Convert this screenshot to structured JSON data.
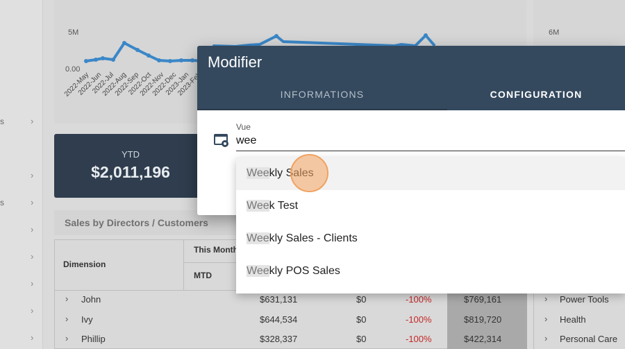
{
  "sidebar": {
    "items": [
      {
        "stub": "s",
        "top": 0
      },
      {
        "stub": "",
        "top": 0
      },
      {
        "stub": "s",
        "top": 0
      },
      {
        "stub": "",
        "top": 0
      },
      {
        "stub": "",
        "top": 0
      },
      {
        "stub": "",
        "top": 0
      },
      {
        "stub": "",
        "top": 0
      },
      {
        "stub": "",
        "top": 0
      }
    ]
  },
  "dashboard": {
    "chart_left": {
      "y_max_label": "5M",
      "y_zero_label": "0.00",
      "x_labels": [
        "2022-May",
        "2022-Jun",
        "2022-Jul",
        "2022-Aug",
        "2022-Sep",
        "2022-Oct",
        "2022-Nov",
        "2022-Dec",
        "2023-Jan",
        "2023-Feb"
      ]
    },
    "chart_right": {
      "y_max_label": "6M"
    },
    "ytd": {
      "label": "YTD",
      "value": "$2,011,196"
    },
    "section_title": "Sales by Directors / Customers",
    "table": {
      "dimension_header": "Dimension",
      "month_header": "This Month",
      "mtd_header": "MTD",
      "rows": [
        {
          "name": "John",
          "mtd": "$631,131",
          "zero": "$0",
          "pct": "-100%",
          "ly": "$769,161"
        },
        {
          "name": "Ivy",
          "mtd": "$644,534",
          "zero": "$0",
          "pct": "-100%",
          "ly": "$819,720"
        },
        {
          "name": "Phillip",
          "mtd": "$328,337",
          "zero": "$0",
          "pct": "-100%",
          "ly": "$422,314"
        }
      ]
    },
    "right_list": [
      "Power Tools",
      "Health",
      "Personal Care"
    ]
  },
  "modal": {
    "title": "Modifier",
    "tabs": {
      "info": "INFORMATIONS",
      "config": "CONFIGURATION"
    },
    "active_tab": "CONFIGURATION",
    "field": {
      "label": "Vue",
      "value": "wee"
    },
    "options": [
      {
        "match": "Wee",
        "rest": "kly Sales"
      },
      {
        "match": "Wee",
        "rest": "k Test"
      },
      {
        "match": "Wee",
        "rest": "kly Sales - Clients"
      },
      {
        "match": "Wee",
        "rest": "kly POS Sales"
      }
    ]
  },
  "colors": {
    "header": "#34495e",
    "ytd_card": "#2f3d4e",
    "negative": "#c62828",
    "click_ring": "#f0a261"
  }
}
